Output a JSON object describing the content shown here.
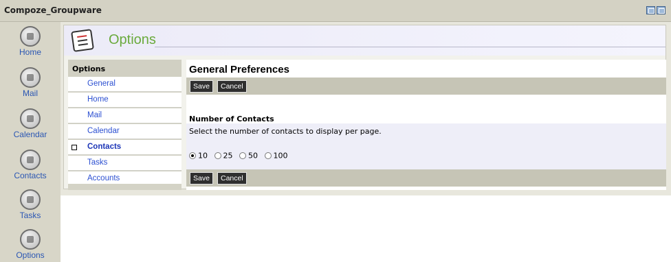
{
  "app": {
    "title": "Compoze_Groupware"
  },
  "nav": {
    "items": [
      {
        "label": "Home",
        "icon": "home-icon"
      },
      {
        "label": "Mail",
        "icon": "mail-icon"
      },
      {
        "label": "Calendar",
        "icon": "calendar-icon"
      },
      {
        "label": "Contacts",
        "icon": "contacts-icon"
      },
      {
        "label": "Tasks",
        "icon": "tasks-icon"
      },
      {
        "label": "Options",
        "icon": "options-icon"
      }
    ]
  },
  "header": {
    "title": "Options",
    "icon": "options-checklist-icon"
  },
  "menu": {
    "title": "Options",
    "items": [
      {
        "label": "General"
      },
      {
        "label": "Home"
      },
      {
        "label": "Mail"
      },
      {
        "label": "Calendar"
      },
      {
        "label": "Contacts",
        "active": true
      },
      {
        "label": "Tasks"
      },
      {
        "label": "Accounts"
      }
    ]
  },
  "panel": {
    "title": "General Preferences",
    "save_label": "Save",
    "cancel_label": "Cancel",
    "section_title": "Number of Contacts",
    "section_desc": "Select the number of contacts to display per page.",
    "options": [
      {
        "label": "10",
        "checked": true
      },
      {
        "label": "25",
        "checked": false
      },
      {
        "label": "50",
        "checked": false
      },
      {
        "label": "100",
        "checked": false
      }
    ]
  },
  "colors": {
    "link": "#2b4fd1",
    "header_title": "#6aaa3c",
    "bar": "#c6c5b6"
  }
}
